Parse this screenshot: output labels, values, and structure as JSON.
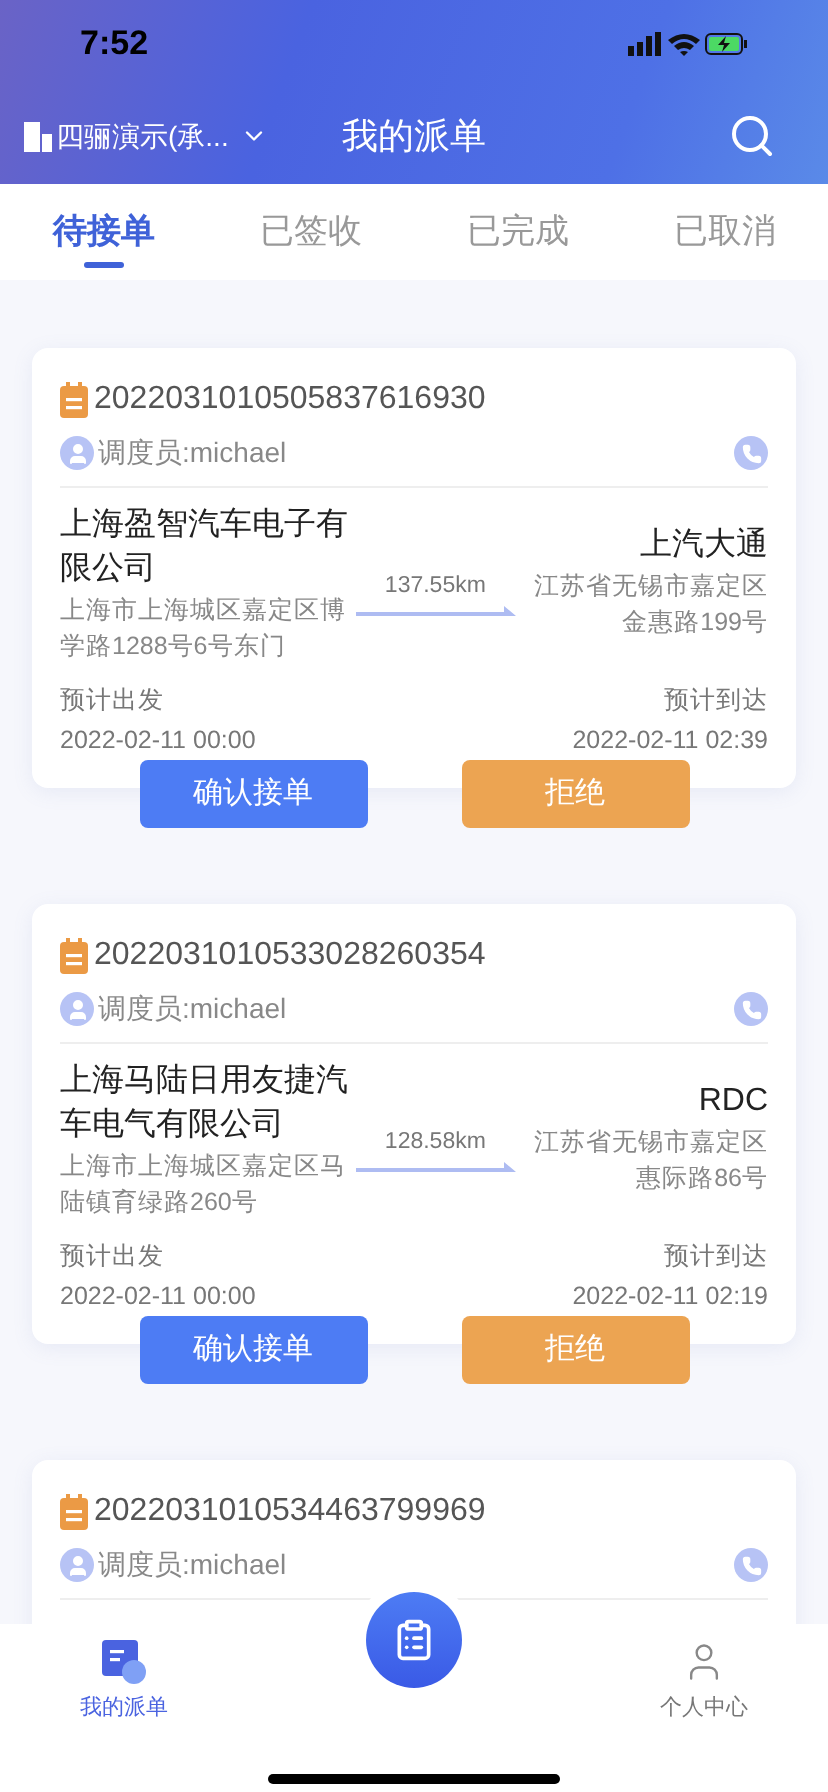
{
  "status_bar": {
    "time": "7:52"
  },
  "header": {
    "company": "四骊演示(承...",
    "title": "我的派单"
  },
  "tabs": [
    {
      "label": "待接单",
      "selected": true
    },
    {
      "label": "已签收",
      "selected": false
    },
    {
      "label": "已完成",
      "selected": false
    },
    {
      "label": "已取消",
      "selected": false
    }
  ],
  "orders": [
    {
      "number": "2022031010505837616930",
      "dispatcher": "调度员:michael",
      "from_name": "上海盈智汽车电子有限公司",
      "from_address": "上海市上海城区嘉定区博学路1288号6号东门",
      "distance": "137.55km",
      "to_name": "上汽大通",
      "to_address": "江苏省无锡市嘉定区金惠路199号",
      "depart_label": "预计出发",
      "depart_time": "2022-02-11 00:00",
      "arrive_label": "预计到达",
      "arrive_time": "2022-02-11 02:39",
      "buttons": [
        "确认接单",
        "拒绝"
      ]
    },
    {
      "number": "2022031010533028260354",
      "dispatcher": "调度员:michael",
      "from_name": "上海马陆日用友捷汽车电气有限公司",
      "from_address": "上海市上海城区嘉定区马陆镇育绿路260号",
      "distance": "128.58km",
      "to_name": "RDC",
      "to_address": "江苏省无锡市嘉定区惠际路86号",
      "depart_label": "预计出发",
      "depart_time": "2022-02-11 00:00",
      "arrive_label": "预计到达",
      "arrive_time": "2022-02-11 02:19",
      "buttons": [
        "确认接单",
        "拒绝"
      ]
    },
    {
      "number": "2022031010534463799969",
      "dispatcher": "调度员:michael"
    }
  ],
  "bottom_nav": [
    {
      "label": "我的派单",
      "selected": true
    },
    {
      "label": "个人中心",
      "selected": false
    }
  ]
}
